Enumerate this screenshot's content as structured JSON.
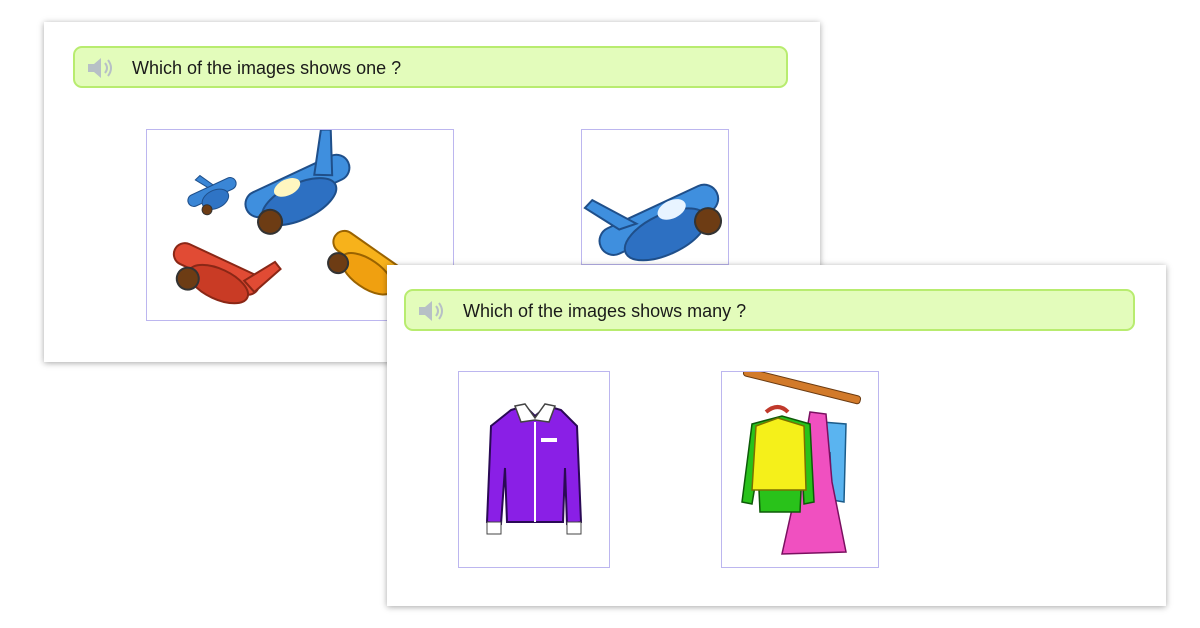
{
  "colors": {
    "question_bar_bg": "#e3fcbb",
    "question_bar_border": "#b8ec6f",
    "option_border": "#bcb6ef"
  },
  "cards": [
    {
      "question": "Which of the images shows one ?",
      "audio_icon": "speaker-icon",
      "options": [
        {
          "image": "many-airplanes"
        },
        {
          "image": "one-airplane"
        }
      ]
    },
    {
      "question": "Which of the images shows many ?",
      "audio_icon": "speaker-icon",
      "options": [
        {
          "image": "one-shirt"
        },
        {
          "image": "many-clothes-on-rack"
        }
      ]
    }
  ]
}
